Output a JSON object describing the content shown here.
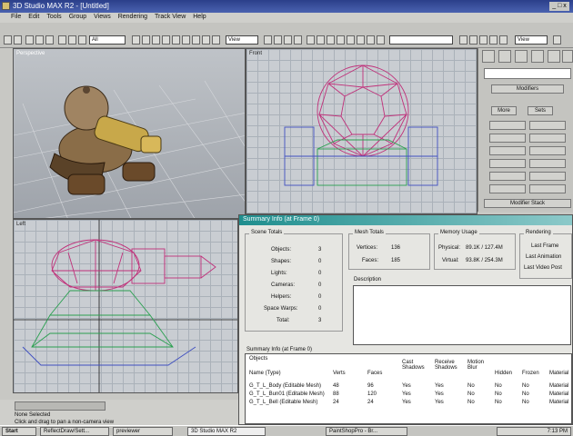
{
  "window": {
    "title": "3D Studio MAX R2 - [Untitled]"
  },
  "menu": [
    "File",
    "Edit",
    "Tools",
    "Group",
    "Views",
    "Rendering",
    "Track View",
    "Help"
  ],
  "toolbar": {
    "selection_filter": "All",
    "coord_system": "View",
    "render_type": "View"
  },
  "viewports": {
    "perspective": "Perspective",
    "front": "Front",
    "left": "Left"
  },
  "command_panel": {
    "modifiers_label": "Modifiers",
    "more_label": "More",
    "sets_label": "Sets",
    "modifier_stack_label": "Modifier Stack"
  },
  "dialog": {
    "title": "Summary Info (at Frame 0)",
    "scene_totals": {
      "heading": "Scene Totals",
      "rows": [
        [
          "Objects:",
          "3"
        ],
        [
          "Shapes:",
          "0"
        ],
        [
          "Lights:",
          "0"
        ],
        [
          "Cameras:",
          "0"
        ],
        [
          "Helpers:",
          "0"
        ],
        [
          "Space Warps:",
          "0"
        ],
        [
          "Total:",
          "3"
        ]
      ]
    },
    "mesh_totals": {
      "heading": "Mesh Totals",
      "vertices_label": "Vertices:",
      "vertices": "136",
      "faces_label": "Faces:",
      "faces": "185"
    },
    "memory_usage": {
      "heading": "Memory Usage",
      "physical_label": "Physical:",
      "physical": "89.1K / 127.4M",
      "virtual_label": "Virtual:",
      "virtual": "93.8K / 254.3M"
    },
    "rendering": {
      "heading": "Rendering",
      "rows": [
        "Last Frame",
        "Last Animation",
        "Last Video Post"
      ]
    },
    "description_label": "Description",
    "summary_label": "Summary Info (at Frame 0)",
    "objects_label": "Objects",
    "columns": [
      "Name (Type)",
      "Verts",
      "Faces",
      "Cast Shadows",
      "Receive Shadows",
      "Motion Blur",
      "Hidden",
      "Frozen",
      "Material"
    ],
    "rows": [
      [
        "G_T_L_Body (Editable Mesh)",
        "48",
        "96",
        "Yes",
        "Yes",
        "No",
        "No",
        "No",
        "Material"
      ],
      [
        "G_T_L_Bun01 (Editable Mesh)",
        "88",
        "120",
        "Yes",
        "Yes",
        "No",
        "No",
        "No",
        "Material"
      ],
      [
        "G_T_L_Bell (Editable Mesh)",
        "24",
        "24",
        "Yes",
        "Yes",
        "No",
        "No",
        "No",
        "Material"
      ]
    ]
  },
  "status": {
    "selection": "None Selected",
    "prompt": "Click and drag to pan a non-camera view"
  },
  "taskbar": {
    "start": "Start",
    "tasks": [
      "ReflectDraw/Sett...",
      "previewer",
      "3D Studio MAX R2",
      "PaintShopPro - Br..."
    ],
    "clock": "7:13 PM"
  },
  "colors": {
    "grid": "#a0a8b0",
    "wire_pink": "#c0307a",
    "wire_green": "#2aa050",
    "wire_blue": "#4050c0",
    "dialog_title": "#1f8e8e"
  }
}
